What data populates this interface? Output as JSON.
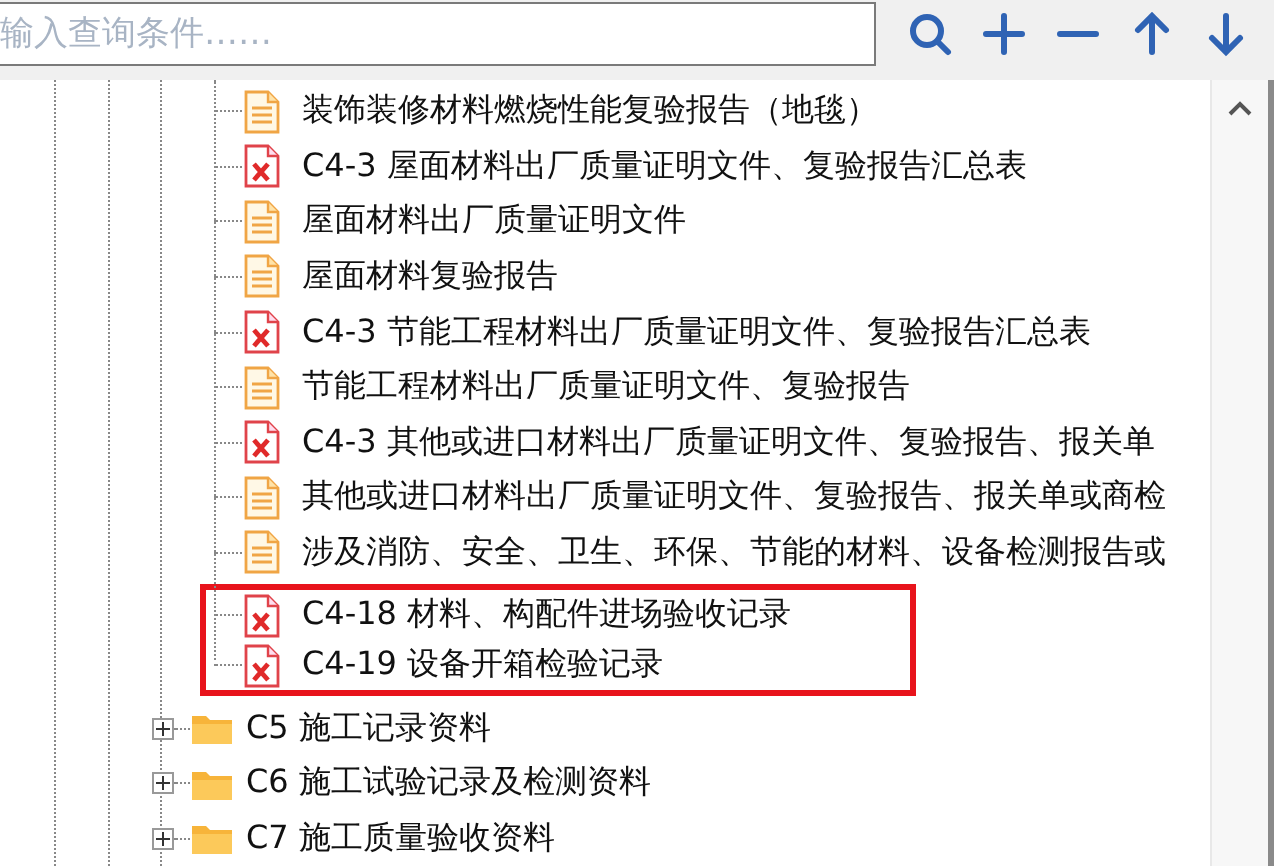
{
  "search": {
    "placeholder": "输入查询条件……"
  },
  "toolbar": {
    "buttons": [
      {
        "kind": "search"
      },
      {
        "kind": "add"
      },
      {
        "kind": "remove"
      },
      {
        "kind": "up"
      },
      {
        "kind": "down"
      }
    ]
  },
  "tree": {
    "documents": [
      {
        "kind": "text",
        "label": "装饰装修材料燃烧性能复验报告（地毯）"
      },
      {
        "kind": "excel",
        "label": "C4-3 屋面材料出厂质量证明文件、复验报告汇总表"
      },
      {
        "kind": "text",
        "label": "屋面材料出厂质量证明文件"
      },
      {
        "kind": "text",
        "label": "屋面材料复验报告"
      },
      {
        "kind": "excel",
        "label": "C4-3 节能工程材料出厂质量证明文件、复验报告汇总表"
      },
      {
        "kind": "text",
        "label": "节能工程材料出厂质量证明文件、复验报告"
      },
      {
        "kind": "excel",
        "label": "C4-3 其他或进口材料出厂质量证明文件、复验报告、报关单"
      },
      {
        "kind": "text",
        "label": "其他或进口材料出厂质量证明文件、复验报告、报关单或商检"
      },
      {
        "kind": "text",
        "label": "涉及消防、安全、卫生、环保、节能的材料、设备检测报告或"
      }
    ],
    "highlighted_documents": [
      {
        "kind": "excel",
        "label": "C4-18 材料、构配件进场验收记录"
      },
      {
        "kind": "excel",
        "label": "C4-19 设备开箱检验记录"
      }
    ],
    "folders": [
      {
        "label": "C5 施工记录资料",
        "expanded": false
      },
      {
        "label": "C6 施工试验记录及检测资料",
        "expanded": false
      },
      {
        "label": "C7 施工质量验收资料",
        "expanded": false
      }
    ]
  }
}
